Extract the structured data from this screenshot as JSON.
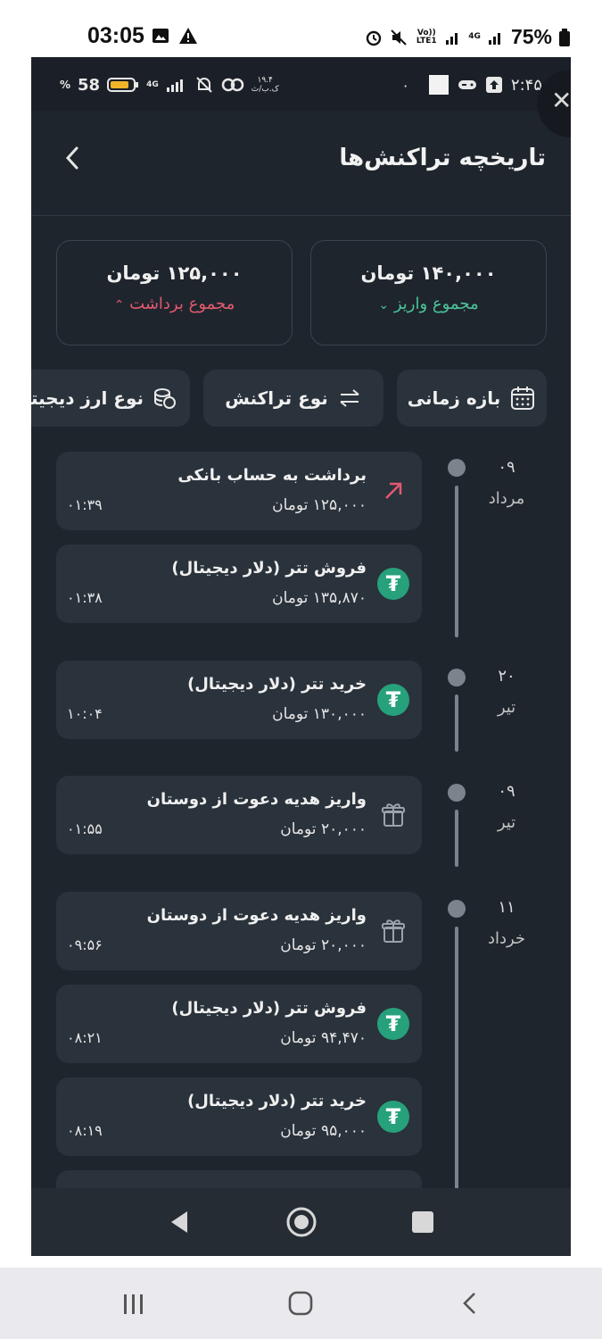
{
  "device_status": {
    "time": "03:05",
    "network_label": "4G",
    "volte_label": "Vo)) LTE1",
    "battery_percent": "75%"
  },
  "inner_status": {
    "battery": "58",
    "percent_sign": "%",
    "network": "4G",
    "speed": "۱۹.۴",
    "speed_unit": "ک.ب/ث",
    "time": "۲:۴۵",
    "dot": "۰"
  },
  "header": {
    "title": "تاریخچه تراکنش‌ها",
    "back_icon": "chevron-left-icon"
  },
  "summary": {
    "deposit": {
      "amount": "۱۴۰,۰۰۰ تومان",
      "label": "مجموع واریز",
      "icon": "double-chevron-down-icon",
      "color": "#4bc59a"
    },
    "withdraw": {
      "amount": "۱۲۵,۰۰۰ تومان",
      "label": "مجموع برداشت",
      "icon": "double-chevron-up-icon",
      "color": "#e2596f"
    }
  },
  "filters": [
    {
      "label": "بازه زمانی",
      "icon": "calendar-icon"
    },
    {
      "label": "نوع تراکنش",
      "icon": "swap-arrows-icon"
    },
    {
      "label": "نوع ارز دیجیتال",
      "icon": "coins-icon"
    }
  ],
  "groups": [
    {
      "day": "۰۹",
      "month": "مرداد"
    },
    {
      "day": "۲۰",
      "month": "تیر"
    },
    {
      "day": "۰۹",
      "month": "تیر"
    },
    {
      "day": "۱۱",
      "month": "خرداد"
    }
  ],
  "transactions": [
    {
      "title": "برداشت به حساب بانکی",
      "amount": "۱۲۵,۰۰۰ تومان",
      "time": "۰۱:۳۹",
      "icon": "arrow-up-right-icon"
    },
    {
      "title": "فروش تتر (دلار دیجیتال)",
      "amount": "۱۳۵,۸۷۰ تومان",
      "time": "۰۱:۳۸",
      "icon": "tether-icon"
    },
    {
      "title": "خرید تتر (دلار دیجیتال)",
      "amount": "۱۳۰,۰۰۰ تومان",
      "time": "۱۰:۰۴",
      "icon": "tether-icon"
    },
    {
      "title": "واریز هدیه دعوت از دوستان",
      "amount": "۲۰,۰۰۰ تومان",
      "time": "۰۱:۵۵",
      "icon": "gift-icon"
    },
    {
      "title": "واریز هدیه دعوت از دوستان",
      "amount": "۲۰,۰۰۰ تومان",
      "time": "۰۹:۵۶",
      "icon": "gift-icon"
    },
    {
      "title": "فروش تتر (دلار دیجیتال)",
      "amount": "۹۴,۴۷۰ تومان",
      "time": "۰۸:۲۱",
      "icon": "tether-icon"
    },
    {
      "title": "خرید تتر (دلار دیجیتال)",
      "amount": "۹۵,۰۰۰ تومان",
      "time": "۰۸:۱۹",
      "icon": "tether-icon"
    }
  ],
  "tether_symbol": "₮"
}
